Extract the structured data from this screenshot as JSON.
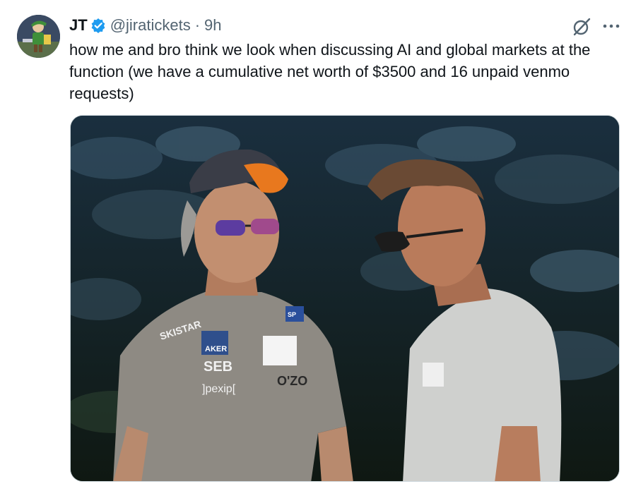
{
  "author": {
    "display_name": "JT",
    "handle": "@jiratickets",
    "separator": "·",
    "time": "9h",
    "verified": true,
    "verified_color": "#1d9bf0"
  },
  "tweet": {
    "text": "how me and bro think we look when discussing AI and global markets at the function (we have a cumulative net worth of $3500 and 16 unpaid venmo requests)"
  },
  "media": {
    "description": "photo",
    "shirt_logos": {
      "brand_1": "SKISTAR",
      "brand_2": "AKER",
      "brand_3": "SEB",
      "brand_4": "]pexip[",
      "brand_5": "O'ZO",
      "badge": "SP"
    }
  },
  "icons": {
    "verified": "verified-badge-icon",
    "grok": "grok-icon",
    "more": "more-icon"
  },
  "colors": {
    "text_primary": "#0f1419",
    "text_secondary": "#536471",
    "accent": "#1d9bf0"
  }
}
